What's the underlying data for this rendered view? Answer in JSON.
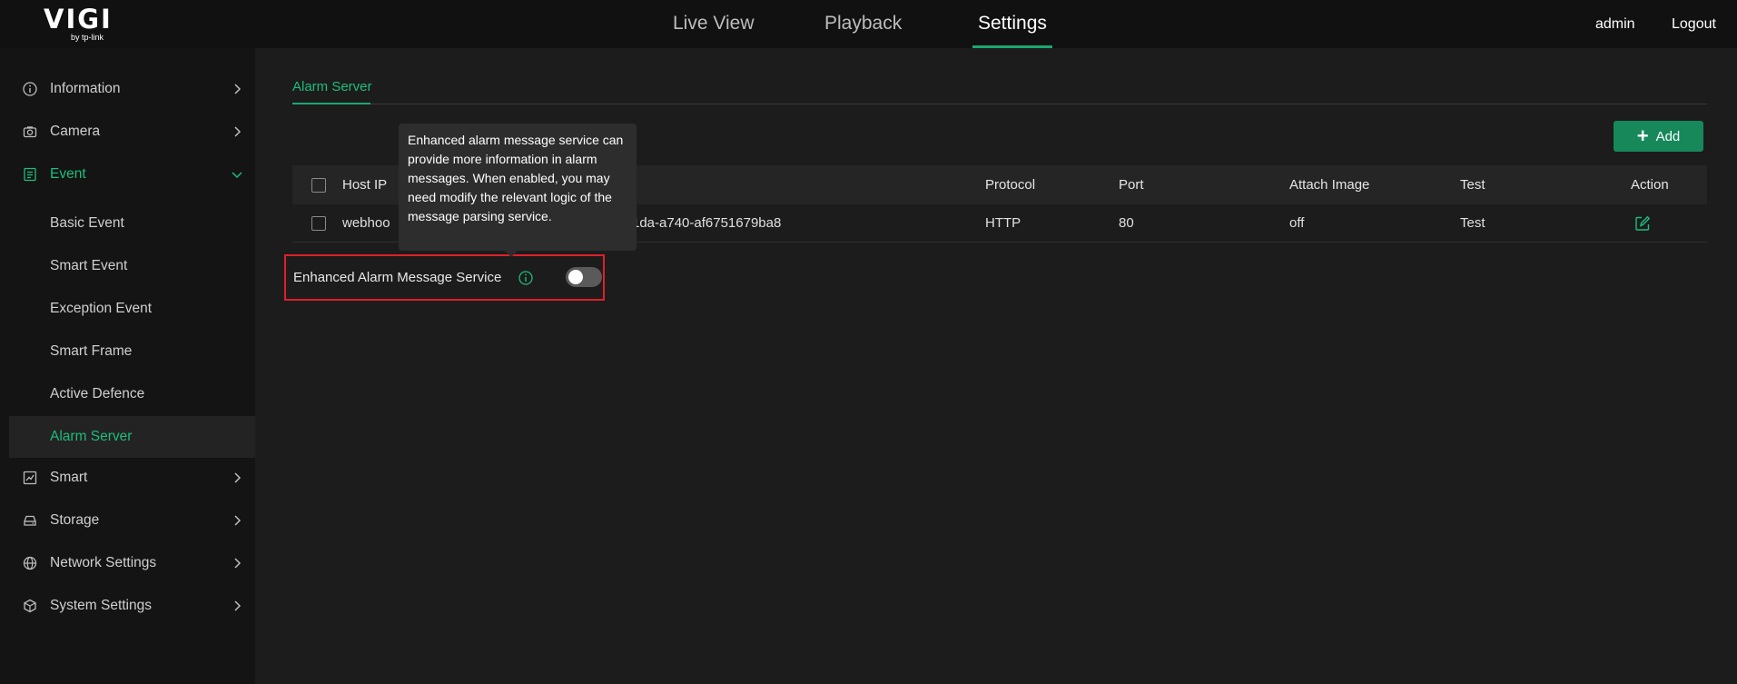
{
  "brand": {
    "name": "VIGI",
    "sub": "by tp-link"
  },
  "topnav": {
    "tabs": [
      "Live View",
      "Playback",
      "Settings"
    ],
    "active": "Settings"
  },
  "user": {
    "name": "admin",
    "logout": "Logout"
  },
  "sidebar": {
    "items": [
      {
        "label": "Information",
        "icon": "info-icon"
      },
      {
        "label": "Camera",
        "icon": "camera-icon"
      },
      {
        "label": "Event",
        "icon": "event-icon"
      },
      {
        "label": "Smart",
        "icon": "chart-icon"
      },
      {
        "label": "Storage",
        "icon": "storage-icon"
      },
      {
        "label": "Network Settings",
        "icon": "globe-icon"
      },
      {
        "label": "System Settings",
        "icon": "cube-icon"
      }
    ],
    "event_sub": [
      "Basic Event",
      "Smart Event",
      "Exception Event",
      "Smart Frame",
      "Active Defence",
      "Alarm Server"
    ],
    "active_sub": "Alarm Server"
  },
  "main": {
    "subtab": "Alarm Server",
    "add_label": "Add",
    "table": {
      "headers": [
        "Host IP",
        "Protocol",
        "Port",
        "Attach Image",
        "Test",
        "Action"
      ],
      "rows": [
        {
          "host_prefix": "webhoo",
          "host_suffix": "1da-a740-af6751679ba8",
          "protocol": "HTTP",
          "port": "80",
          "attach_image": "off",
          "test": "Test"
        }
      ]
    },
    "enhanced": {
      "label": "Enhanced Alarm Message Service",
      "enabled": false,
      "tooltip": "Enhanced alarm message service can provide more information in alarm messages. When enabled, you may need modify the relevant logic of the message parsing service."
    }
  },
  "colors": {
    "accent": "#1aa870",
    "link": "#2f7ff0",
    "highlight": "#e0202a"
  }
}
